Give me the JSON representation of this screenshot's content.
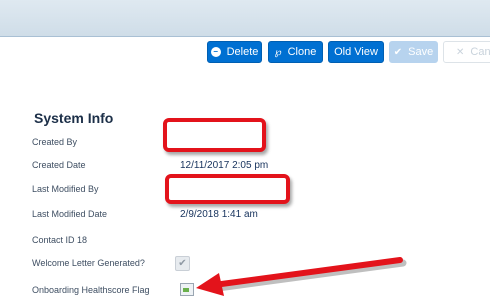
{
  "toolbar": {
    "delete_label": "Delete",
    "clone_label": "Clone",
    "old_view_label": "Old View",
    "save_label": "Save",
    "cancel_label": "Cancel",
    "icons": {
      "delete": "delete-icon",
      "clone": "clone-icon",
      "save": "checkmark-icon",
      "cancel": "close-icon"
    }
  },
  "section": {
    "title": "System Info"
  },
  "fields": {
    "created_by_label": "Created By",
    "created_date_label": "Created Date",
    "created_date_value": "12/11/2017 2:05 pm",
    "last_modified_by_label": "Last Modified By",
    "last_modified_date_label": "Last Modified Date",
    "last_modified_date_value": "2/9/2018 1:41 am",
    "contact_id_label": "Contact ID 18",
    "welcome_letter_label": "Welcome Letter Generated?",
    "welcome_letter_checked": true,
    "healthscore_label": "Onboarding Healthscore Flag"
  },
  "colors": {
    "primary": "#0070d2",
    "annotation": "#e3131b"
  }
}
